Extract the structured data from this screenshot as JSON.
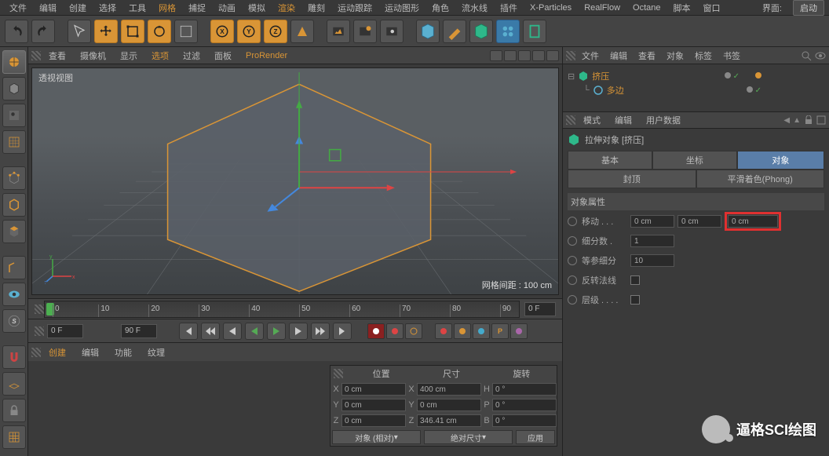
{
  "topbar": {
    "menus": [
      "文件",
      "编辑",
      "创建",
      "选择",
      "工具",
      "网格",
      "捕捉",
      "动画",
      "模拟",
      "渲染",
      "雕刻",
      "运动跟踪",
      "运动图形",
      "角色",
      "流水线",
      "插件",
      "X-Particles",
      "RealFlow",
      "Octane",
      "脚本",
      "窗口"
    ],
    "orange_idx": [
      5,
      9
    ],
    "iface_label": "界面:",
    "layout": "启动"
  },
  "view": {
    "menus": [
      "查看",
      "摄像机",
      "显示",
      "选项",
      "过滤",
      "面板",
      "ProRender"
    ],
    "orange_idx": [
      3,
      6
    ],
    "title": "透视视图",
    "grid_label": "网格间距 : 100 cm"
  },
  "timeline": {
    "ticks": [
      "0",
      "10",
      "20",
      "30",
      "40",
      "50",
      "60",
      "70",
      "80",
      "90"
    ],
    "cur_frame": "0 F"
  },
  "transport": {
    "start": "0 F",
    "end": "90 F"
  },
  "bottabs": {
    "tabs": [
      "创建",
      "编辑",
      "功能",
      "纹理"
    ],
    "orange_idx": [
      0
    ]
  },
  "coord": {
    "headers": [
      "位置",
      "尺寸",
      "旋转"
    ],
    "rows": [
      {
        "ax": "X",
        "pos": "0 cm",
        "size": "400 cm",
        "rot_ax": "H",
        "rot": "0 °"
      },
      {
        "ax": "Y",
        "pos": "0 cm",
        "size": "0 cm",
        "rot_ax": "P",
        "rot": "0 °"
      },
      {
        "ax": "Z",
        "pos": "0 cm",
        "size": "346.41 cm",
        "rot_ax": "B",
        "rot": "0 °"
      }
    ],
    "sel1": "对象 (相对)",
    "sel2": "绝对尺寸",
    "apply": "应用"
  },
  "obj": {
    "menus": [
      "文件",
      "编辑",
      "查看",
      "对象",
      "标签",
      "书签"
    ],
    "tree": [
      {
        "name": "挤压",
        "indent": 0,
        "color": "#2eb88a"
      },
      {
        "name": "多边",
        "indent": 1,
        "color": "#5ab0d0"
      }
    ]
  },
  "attr": {
    "menus": [
      "模式",
      "编辑",
      "用户数据"
    ],
    "title": "拉伸对象 [挤压]",
    "tabs": [
      "基本",
      "坐标",
      "对象",
      "封顶",
      "平滑着色(Phong)"
    ],
    "active_tab": 2,
    "section_title": "对象属性",
    "rows": {
      "move_label": "移动 . . .",
      "move_vals": [
        "0 cm",
        "0 cm",
        "0 cm"
      ],
      "subdiv_label": "细分数 .",
      "subdiv_val": "1",
      "iso_label": "等参细分",
      "iso_val": "10",
      "flip_label": "反转法线",
      "hier_label": "层级 . . . ."
    }
  },
  "watermark": "逼格SCI绘图"
}
